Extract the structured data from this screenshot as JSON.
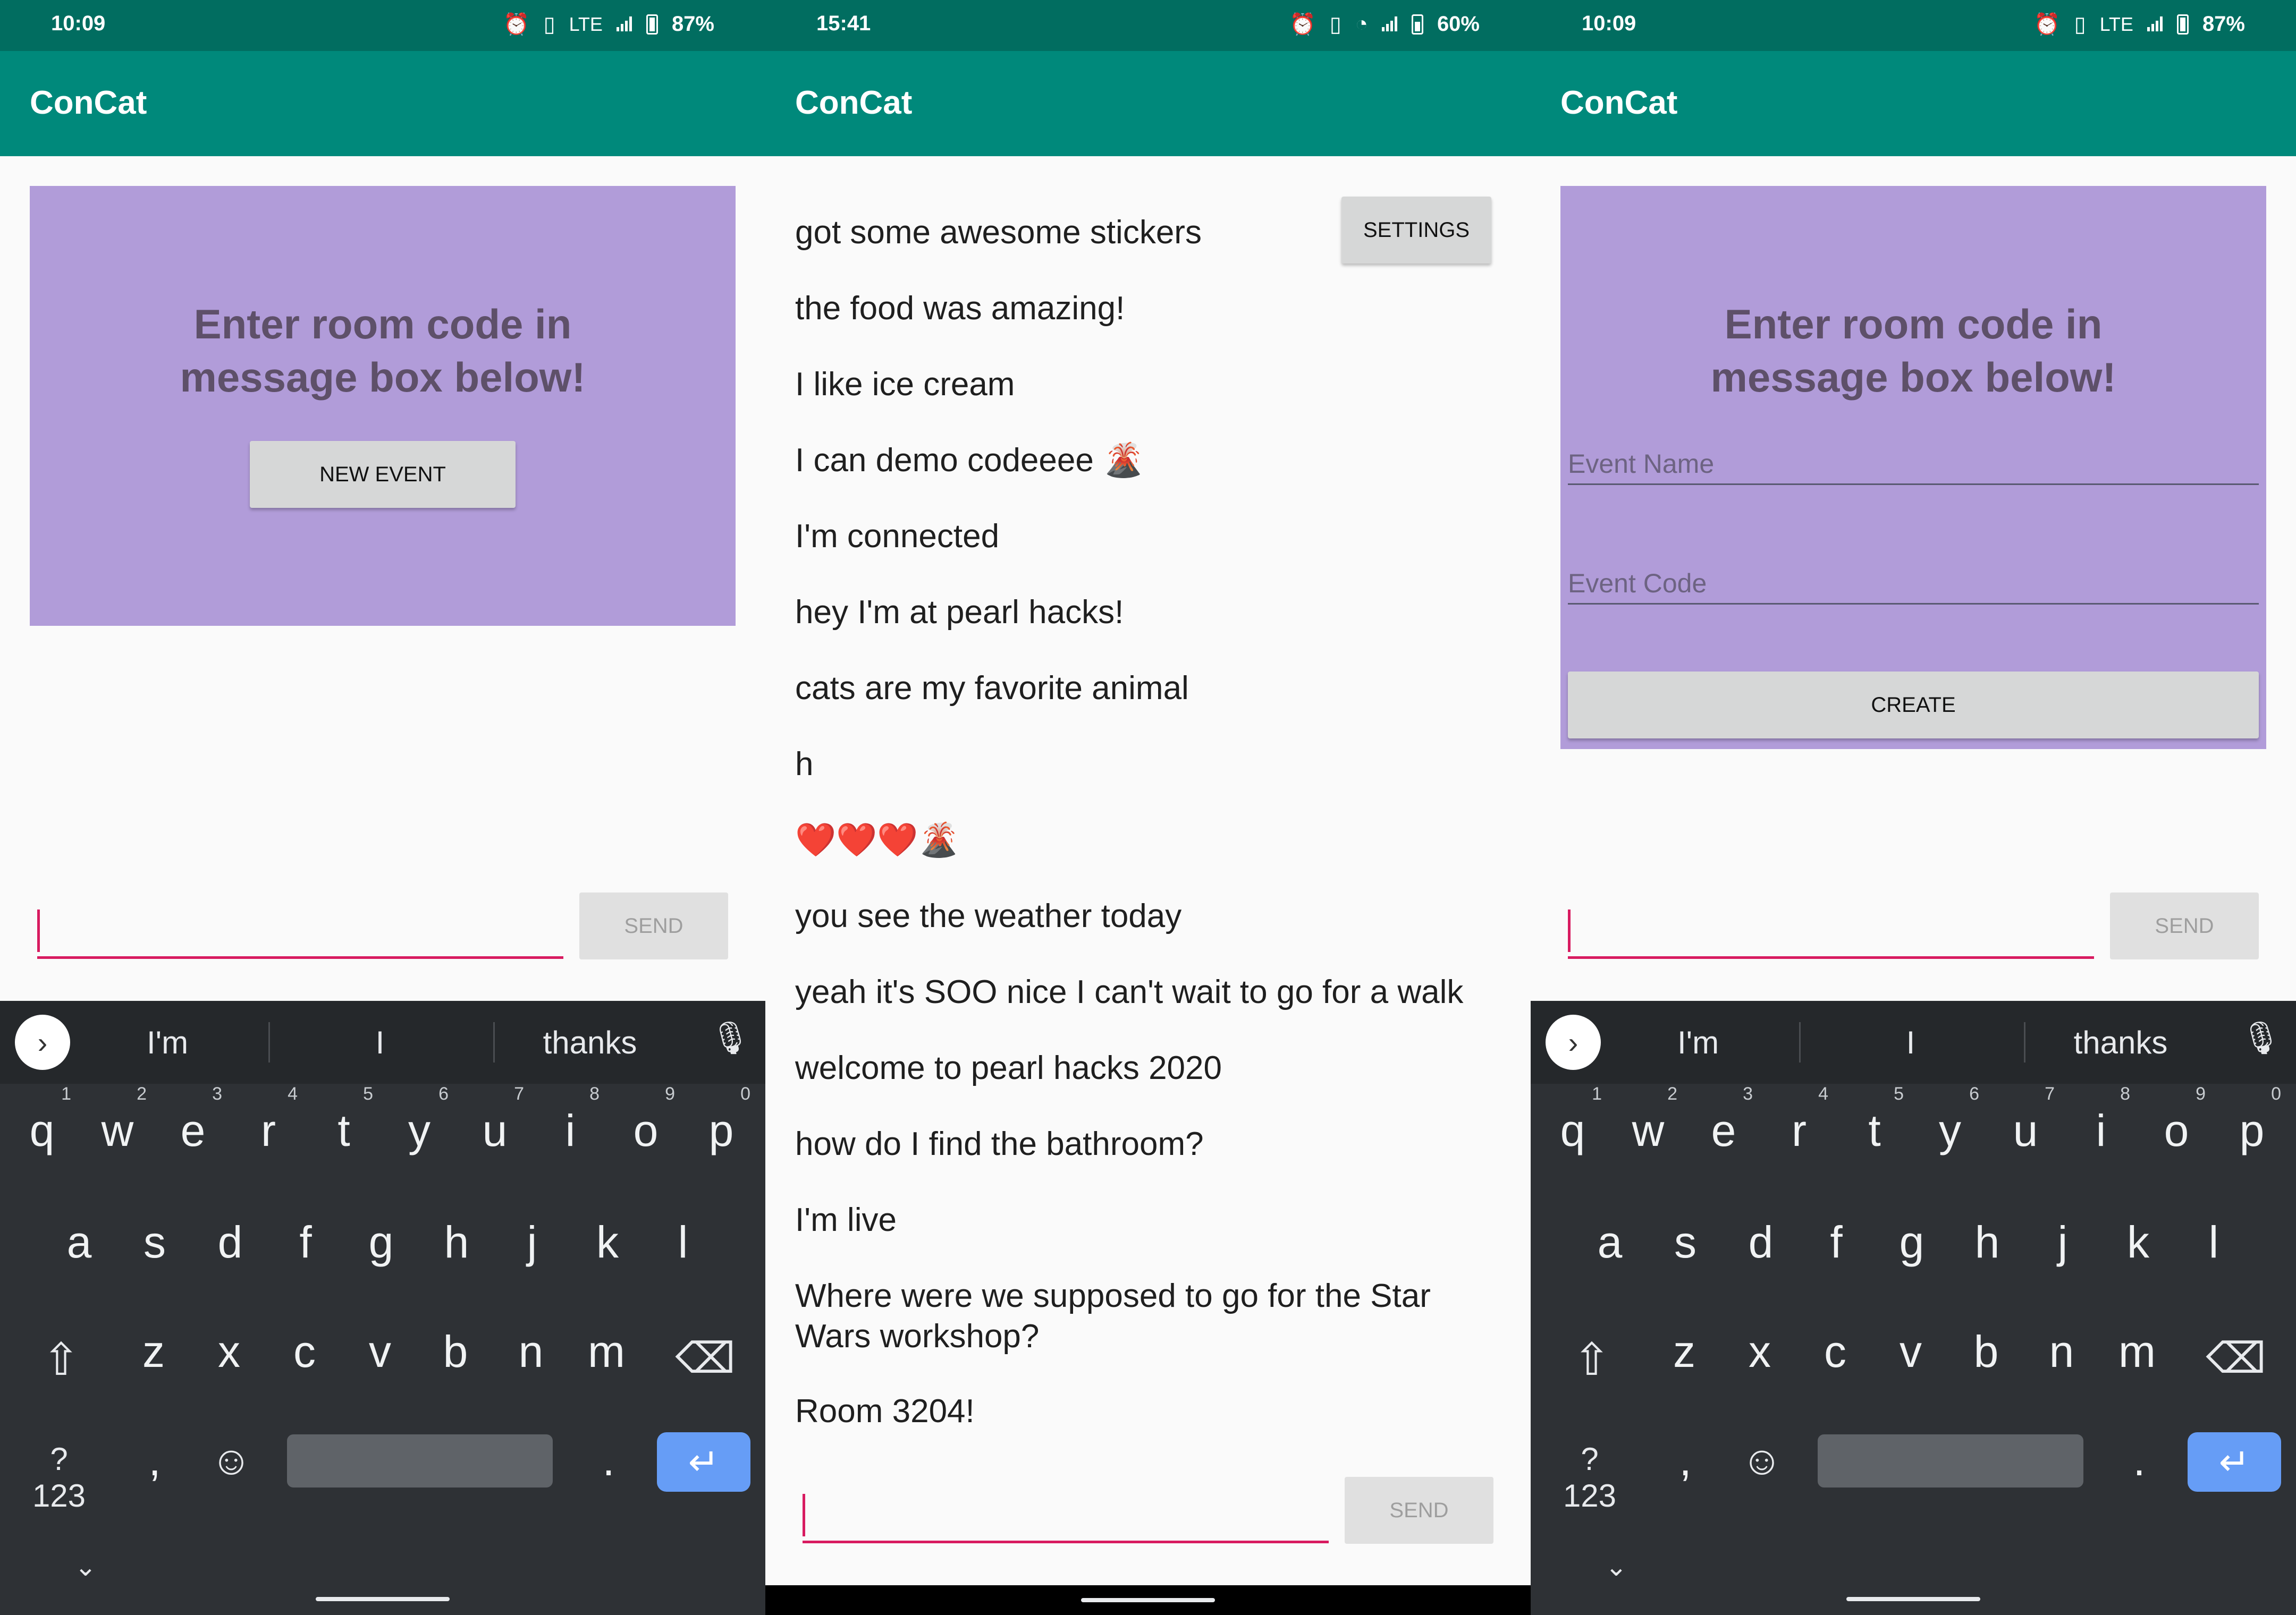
{
  "screens": [
    {
      "status": {
        "time": "10:09",
        "network": "LTE",
        "battery": "87%"
      },
      "app_title": "ConCat",
      "card": {
        "heading_line1": "Enter room code in",
        "heading_line2": "message box below!",
        "button_label": "NEW EVENT"
      },
      "send_label": "SEND"
    },
    {
      "status": {
        "time": "15:41",
        "battery": "60%"
      },
      "app_title": "ConCat",
      "settings_label": "SETTINGS",
      "messages": [
        "got some awesome stickers",
        "the food was amazing!",
        "I like ice cream",
        "I can demo codeeee 🌋",
        "I'm connected",
        "hey I'm at pearl hacks!",
        "cats are my favorite animal",
        "h",
        "❤️❤️❤️🌋",
        "you see the weather today",
        "yeah it's SOO nice I can't wait to go for a walk",
        "welcome to pearl hacks 2020",
        "how do I find the bathroom?",
        "I'm live",
        "Where were we supposed to go for the Star Wars workshop?",
        "Room 3204!"
      ],
      "send_label": "SEND"
    },
    {
      "status": {
        "time": "10:09",
        "network": "LTE",
        "battery": "87%"
      },
      "app_title": "ConCat",
      "card": {
        "heading_line1": "Enter room code in",
        "heading_line2": "message box below!",
        "event_name_placeholder": "Event Name",
        "event_code_placeholder": "Event Code",
        "create_label": "CREATE"
      },
      "send_label": "SEND"
    }
  ],
  "keyboard": {
    "suggestions": [
      "I'm",
      "I",
      "thanks"
    ],
    "row1": [
      "q",
      "w",
      "e",
      "r",
      "t",
      "y",
      "u",
      "i",
      "o",
      "p"
    ],
    "row1_digits": [
      "1",
      "2",
      "3",
      "4",
      "5",
      "6",
      "7",
      "8",
      "9",
      "0"
    ],
    "row2": [
      "a",
      "s",
      "d",
      "f",
      "g",
      "h",
      "j",
      "k",
      "l"
    ],
    "row3": [
      "z",
      "x",
      "c",
      "v",
      "b",
      "n",
      "m"
    ],
    "symbols_key": "?123",
    "comma_key": ",",
    "period_key": "."
  },
  "icons": {
    "alarm": "alarm-icon",
    "vibrate": "vibrate-icon",
    "signal": "signal-icon",
    "wifi": "wifi-icon",
    "battery": "battery-icon",
    "mic": "mic-icon",
    "shift": "shift-icon",
    "backspace": "backspace-icon",
    "emoji": "emoji-icon",
    "enter": "enter-icon",
    "expand": "chevron-right-icon",
    "collapse": "chevron-down-icon"
  },
  "colors": {
    "status_bar": "#016d60",
    "app_bar": "#00897b",
    "card": "#b19cd9",
    "accent": "#d81b60",
    "keyboard": "#2e3135",
    "enter_key": "#669df6"
  }
}
